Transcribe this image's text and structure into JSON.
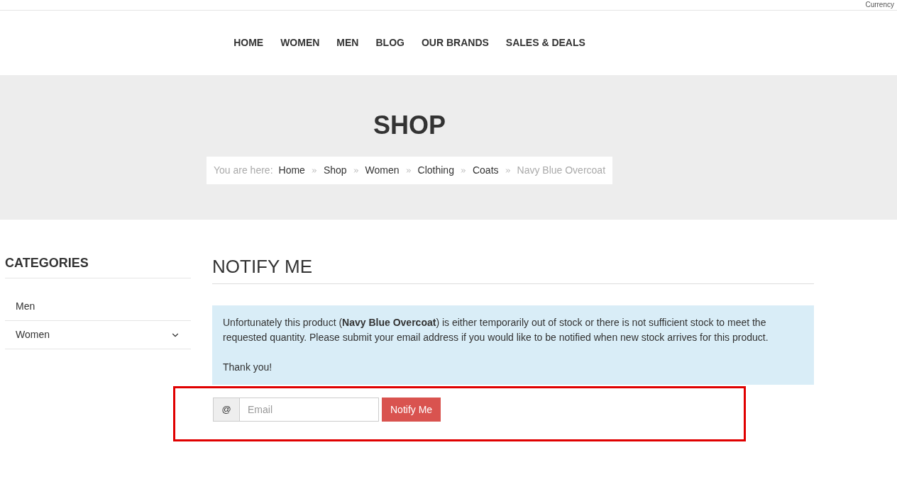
{
  "top_bar": {
    "currency_label": "Currency"
  },
  "nav": [
    {
      "label": "HOME"
    },
    {
      "label": "WOMEN"
    },
    {
      "label": "MEN"
    },
    {
      "label": "BLOG"
    },
    {
      "label": "OUR BRANDS"
    },
    {
      "label": "SALES & DEALS"
    }
  ],
  "banner": {
    "title": "SHOP",
    "breadcrumb": {
      "prefix": "You are here:",
      "links": [
        "Home",
        "Shop",
        "Women",
        "Clothing",
        "Coats"
      ],
      "current": "Navy Blue Overcoat"
    }
  },
  "sidebar": {
    "title": "CATEGORIES",
    "items": [
      {
        "label": "Men",
        "has_children": false
      },
      {
        "label": "Women",
        "has_children": true
      }
    ]
  },
  "main": {
    "title": "NOTIFY ME",
    "message": "Unfortunately this product (**Navy Blue Overcoat**) is either temporarily out of stock or there is not sufficient stock to meet the requested quantity. Please submit your email address if you would like to be notified when new stock arrives for this product.",
    "thanks": "Thank you!",
    "form": {
      "addon": "@",
      "placeholder": "Email",
      "button": "Notify Me",
      "highlighted": true
    }
  }
}
